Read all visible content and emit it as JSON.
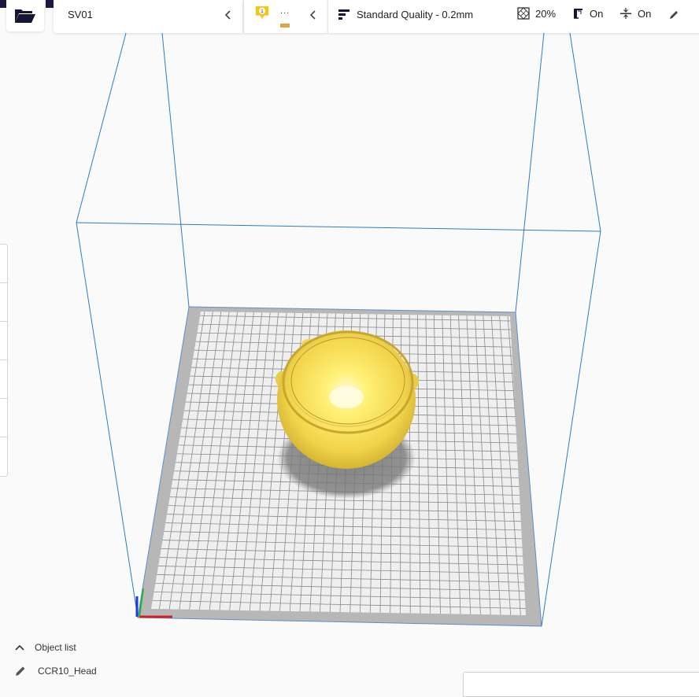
{
  "printer": {
    "name": "SV01"
  },
  "material": {
    "extruder_number": "1",
    "name_truncated": "...",
    "color": "#d9a640"
  },
  "print_settings": {
    "quality": "Standard Quality - 0.2mm",
    "infill": "20%",
    "support": "On",
    "adhesion": "On"
  },
  "object_list": {
    "toggle_label": "Object list",
    "item_name": "CCR10_Head"
  },
  "colors": {
    "accent": "#196ef0",
    "build_volume_lines": "#2e7bc4",
    "model_yellow": "#f8e35a",
    "badge_yellow": "#f5c518",
    "dark_corner": "#1b1a3e"
  },
  "icons": {
    "open_file": "folder-open-icon",
    "printer_collapse": "chevron-left-icon",
    "material_collapse": "chevron-left-icon",
    "quality": "quality-bars-icon",
    "infill": "infill-icon",
    "support": "support-icon",
    "adhesion": "adhesion-icon",
    "edit": "pencil-icon",
    "object_list_toggle": "chevron-up-icon",
    "object_item": "pencil-icon"
  }
}
